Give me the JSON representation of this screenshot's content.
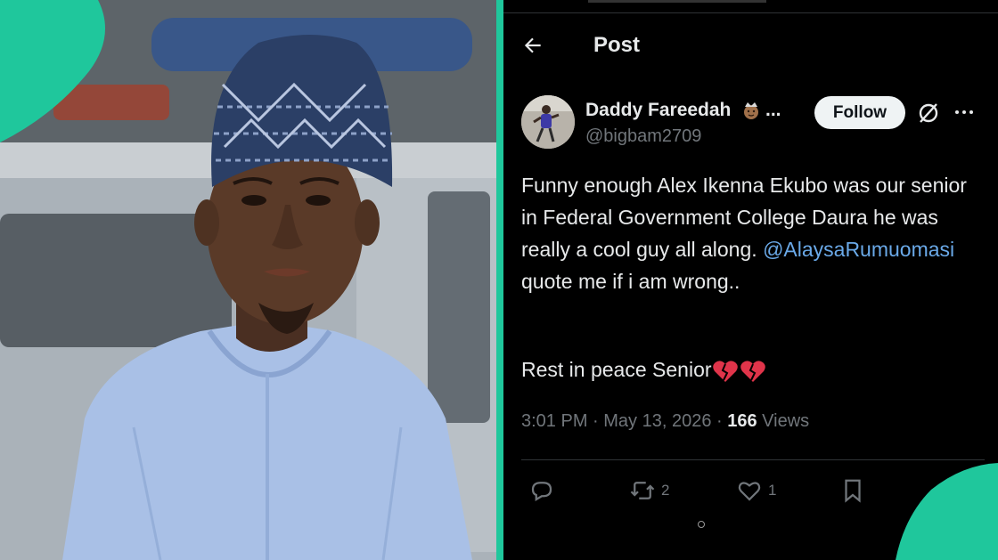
{
  "colors": {
    "accent": "#1fc79c",
    "tweet_background": "#000000",
    "mention": "#6aa9e8",
    "secondary_text": "#71767b"
  },
  "header": {
    "title": "Post",
    "back_icon": "back-arrow-icon"
  },
  "author": {
    "display_name": "Daddy Fareedah",
    "name_emoji_icon": "crown-face-emoji-icon",
    "name_ellipsis": "...",
    "handle": "@bigbam2709",
    "follow_label": "Follow"
  },
  "tweet": {
    "text_main": "Funny enough Alex Ikenna Ekubo was our senior in Federal Government College Daura he was really a cool guy all along.",
    "mention": "@AlaysaRumuomasi",
    "text_after_mention": " quote me if i am wrong..",
    "rest_line": "Rest in peace Senior",
    "rest_emoji_icon": "broken-heart-icon"
  },
  "meta": {
    "time": "3:01 PM",
    "separator": " · ",
    "date": "May 13, 2026",
    "views_count": "166",
    "views_label": " Views"
  },
  "actions": {
    "reply_count": "",
    "repost_count": "2",
    "like_count": "1",
    "bookmark_count": ""
  }
}
